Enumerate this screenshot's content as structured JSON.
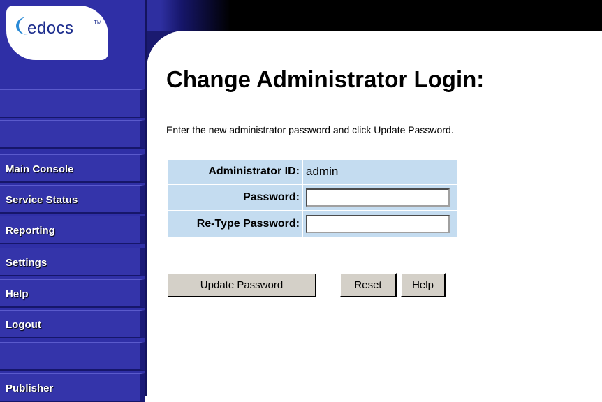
{
  "logo": {
    "text": "edocs",
    "tm": "TM"
  },
  "sidebar": {
    "items": [
      {
        "label": ""
      },
      {
        "label": ""
      },
      {
        "label": "Main Console"
      },
      {
        "label": "Service Status"
      },
      {
        "label": "Reporting"
      },
      {
        "label": "Settings"
      },
      {
        "label": "Help"
      },
      {
        "label": "Logout"
      },
      {
        "label": ""
      },
      {
        "label": "Publisher"
      }
    ]
  },
  "page": {
    "title": "Change Administrator Login:",
    "intro": "Enter the new administrator password and click Update Password."
  },
  "form": {
    "admin_id_label": "Administrator ID:",
    "admin_id_value": "admin",
    "password_label": "Password:",
    "password_value": "",
    "retype_label": "Re-Type Password:",
    "retype_value": ""
  },
  "buttons": {
    "update": "Update Password",
    "reset": "Reset",
    "help": "Help"
  },
  "colors": {
    "sidebar": "#2f2fa6",
    "form_cell": "#c4dcf0",
    "button": "#d4d0c8"
  }
}
